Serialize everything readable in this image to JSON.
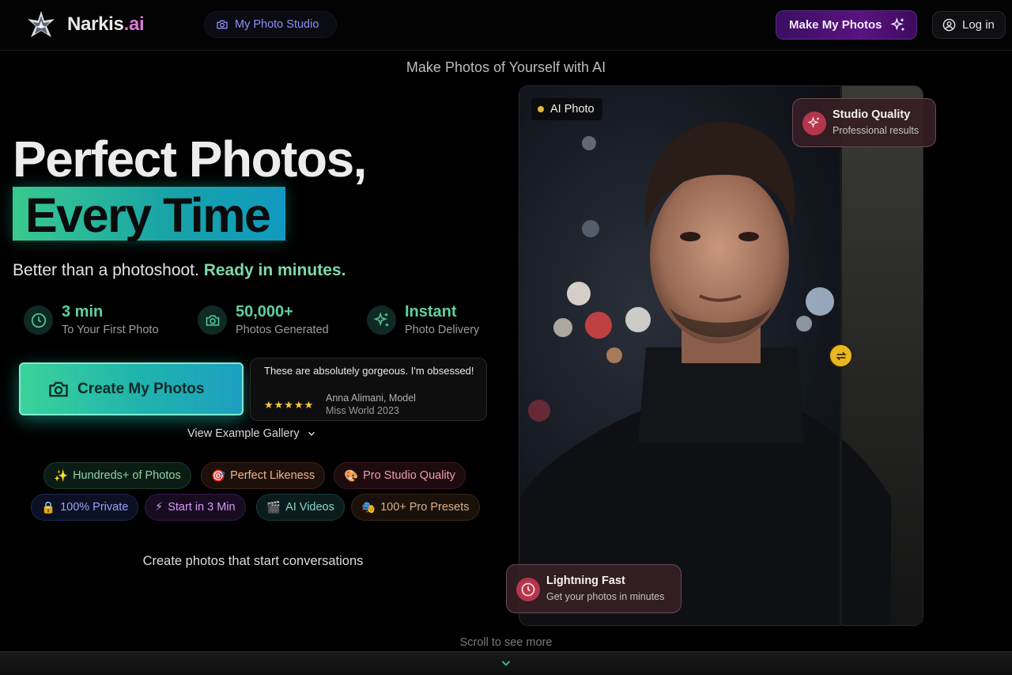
{
  "nav": {
    "brand_main": "Narkis",
    "brand_suffix": ".ai",
    "studio_label": "My Photo Studio",
    "make_label": "Make My Photos",
    "login_label": "Log in"
  },
  "tagline": "Make Photos of Yourself with AI",
  "hero": {
    "line1": "Perfect Photos,",
    "line2": "Every Time",
    "sub_plain": "Better than a photoshoot.",
    "sub_highlight": "Ready in minutes."
  },
  "stats": [
    {
      "value": "3 min",
      "label": "To Your First Photo",
      "icon": "clock-icon"
    },
    {
      "value": "50,000+",
      "label": "Photos Generated",
      "icon": "camera-icon"
    },
    {
      "value": "Instant",
      "label": "Photo Delivery",
      "icon": "sparkle-icon"
    }
  ],
  "cta_label": "Create My Photos",
  "review": {
    "quote": "These are absolutely gorgeous. I'm obsessed!",
    "stars": "★★★★★",
    "name": "Anna Alimani, Model",
    "title": "Miss World 2023"
  },
  "gallery_label": "View Example Gallery",
  "pills": [
    {
      "emoji": "✨",
      "label": "Hundreds+ of Photos"
    },
    {
      "emoji": "🎯",
      "label": "Perfect Likeness"
    },
    {
      "emoji": "🎨",
      "label": "Pro Studio Quality"
    },
    {
      "emoji": "🔒",
      "label": "100% Private"
    },
    {
      "emoji": "⚡",
      "label": "Start in 3 Min"
    },
    {
      "emoji": "🎬",
      "label": "AI Videos"
    },
    {
      "emoji": "🎭",
      "label": "100+ Pro Presets"
    }
  ],
  "conversations": "Create photos that start conversations",
  "photo": {
    "ai_badge": "AI Photo",
    "studio_card_title": "Studio Quality",
    "studio_card_sub": "Professional results",
    "fast_card_title": "Lightning Fast",
    "fast_card_sub": "Get your photos in minutes"
  },
  "scroll_hint": "Scroll to see more",
  "colors": {
    "accent_green": "#5fd2a0",
    "brand_pink": "#d67ad6",
    "cta_gradient_start": "#3bd39b",
    "cta_gradient_end": "#1d9fc0",
    "handle_yellow": "#e8b722"
  }
}
